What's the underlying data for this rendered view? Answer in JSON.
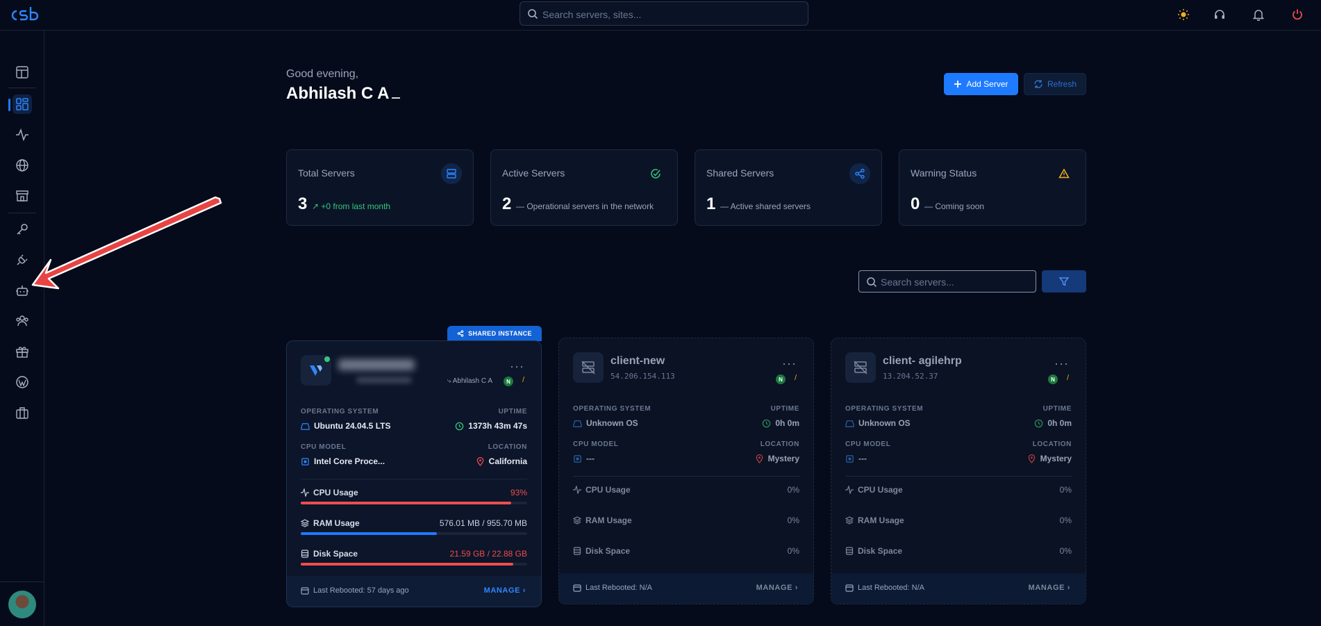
{
  "search": {
    "placeholder": "Search servers, sites..."
  },
  "greeting": {
    "salutation": "Good evening,",
    "name": "Abhilash C A"
  },
  "actions": {
    "add_server": "Add Server",
    "refresh": "Refresh"
  },
  "stats": [
    {
      "title": "Total Servers",
      "value": "3",
      "sub": "+0 from last month",
      "icon": "server-icon"
    },
    {
      "title": "Active Servers",
      "value": "2",
      "sub": "Operational servers in the network",
      "icon": "check-circle-icon"
    },
    {
      "title": "Shared Servers",
      "value": "1",
      "sub": "Active shared servers",
      "icon": "share-icon"
    },
    {
      "title": "Warning Status",
      "value": "0",
      "sub": "Coming soon",
      "icon": "warning-icon"
    }
  ],
  "filter": {
    "placeholder": "Search servers..."
  },
  "labels": {
    "operating_system": "OPERATING SYSTEM",
    "uptime": "UPTIME",
    "cpu_model": "CPU MODEL",
    "location": "LOCATION",
    "cpu_usage": "CPU Usage",
    "ram_usage": "RAM Usage",
    "disk_space": "Disk Space",
    "manage": "MANAGE",
    "shared_instance": "SHARED INSTANCE",
    "badge_n": "N"
  },
  "servers": [
    {
      "owner": "Abhilash C A",
      "os": "Ubuntu 24.04.5 LTS",
      "uptime": "1373h 43m 47s",
      "cpu_model": "Intel Core Proce...",
      "location": "California",
      "cpu_usage": "93%",
      "cpu_fraction": 0.93,
      "ram_usage": "576.01 MB / 955.70 MB",
      "ram_fraction": 0.6,
      "disk_space": "21.59 GB / 22.88 GB",
      "disk_fraction": 0.94,
      "last_rebooted": "Last Rebooted: 57 days ago"
    },
    {
      "name": "client-new",
      "ip": "54.206.154.113",
      "os": "Unknown OS",
      "uptime": "0h 0m",
      "cpu_model": "---",
      "location": "Mystery",
      "cpu_usage": "0%",
      "ram_usage": "0%",
      "disk_space": "0%",
      "last_rebooted": "Last Rebooted: N/A"
    },
    {
      "name": "client- agilehrp",
      "ip": "13.204.52.37",
      "os": "Unknown OS",
      "uptime": "0h 0m",
      "cpu_model": "---",
      "location": "Mystery",
      "cpu_usage": "0%",
      "ram_usage": "0%",
      "disk_space": "0%",
      "last_rebooted": "Last Rebooted: N/A"
    }
  ],
  "colors": {
    "accent": "#1e7bff",
    "success": "#34c77b",
    "danger": "#ef4d4d",
    "warning": "#f2b01e",
    "annotation": "#e84444"
  }
}
